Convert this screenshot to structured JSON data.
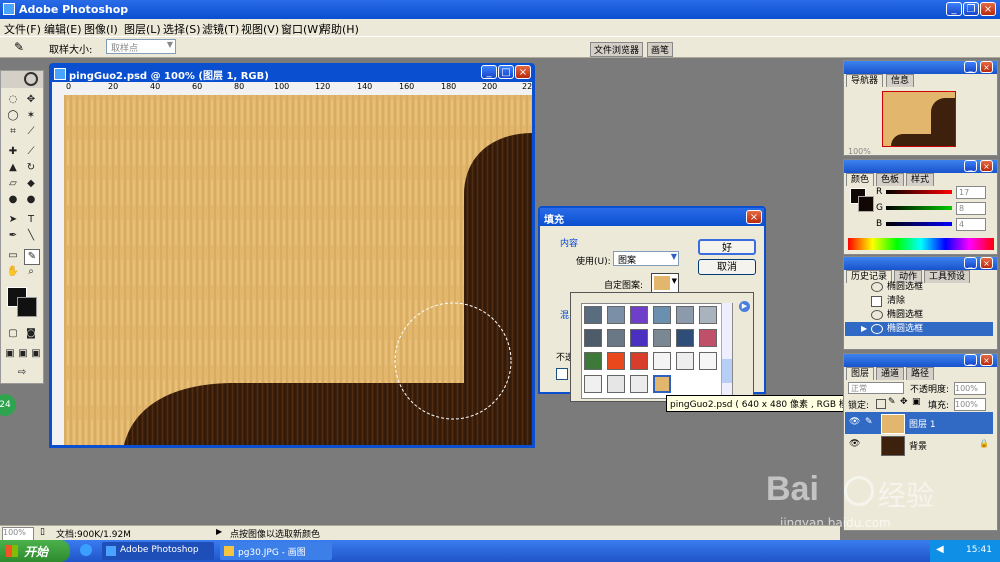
{
  "app": {
    "title": "Adobe Photoshop",
    "menus": [
      "文件(F)",
      "编辑(E)",
      "图像(I)",
      "图层(L)",
      "选择(S)",
      "滤镜(T)",
      "视图(V)",
      "窗口(W)",
      "帮助(H)"
    ]
  },
  "options": {
    "sample_label": "取样大小:",
    "sample_value": "取样点",
    "file_browser": "文件浏览器",
    "brushes": "画笔"
  },
  "document": {
    "title": "pingGuo2.psd @ 100% (图层 1, RGB)",
    "ruler_ticks": [
      "0",
      "20",
      "40",
      "60",
      "80",
      "100",
      "120",
      "140",
      "160",
      "180",
      "200",
      "22"
    ]
  },
  "fill_dialog": {
    "title": "填充",
    "contents_label": "内容",
    "use_label": "使用(U):",
    "use_value": "图案",
    "custom_pattern_label": "自定图案:",
    "blend_label": "混",
    "opacity_label": "不透",
    "ok": "好",
    "cancel": "取消"
  },
  "tooltip": "pingGuo2.psd ( 640 x 480 像素 , RGB 模式 )",
  "panels": {
    "navigator_tabs": [
      "导航器",
      "信息"
    ],
    "nav_zoom": "100%",
    "color_tabs": [
      "颜色",
      "色板",
      "样式"
    ],
    "color_channels": [
      {
        "label": "R",
        "value": "17"
      },
      {
        "label": "G",
        "value": "8"
      },
      {
        "label": "B",
        "value": "4"
      }
    ],
    "history_tabs": [
      "历史记录",
      "动作",
      "工具预设"
    ],
    "history_items": [
      "椭圆选框",
      "清除",
      "椭圆选框",
      "椭圆选框"
    ],
    "layers_tabs": [
      "图层",
      "通道",
      "路径"
    ],
    "blend_mode": "正常",
    "opacity_label": "不透明度:",
    "opacity_value": "100%",
    "lock_label": "锁定:",
    "fill_label": "填充:",
    "fill_value": "100%",
    "layers": [
      {
        "name": "图层 1",
        "selected": true
      },
      {
        "name": "背景",
        "selected": false
      }
    ]
  },
  "status": {
    "zoom": "100%",
    "doc_info": "文档:900K/1.92M",
    "hint": "点按图像以选取新颜色"
  },
  "taskbar": {
    "start": "开始",
    "items": [
      "Adobe Photoshop",
      "pg30.JPG - 画图"
    ],
    "time": "15:41"
  },
  "watermark": {
    "brand": "Bai",
    "brand2": "经验",
    "url": "jingyan.baidu.com"
  },
  "colors": {
    "xp_blue": "#0a5bd8",
    "wood_light": "#e3b86f",
    "wood_dark": "#3a1f0b"
  },
  "side_badge": "24"
}
